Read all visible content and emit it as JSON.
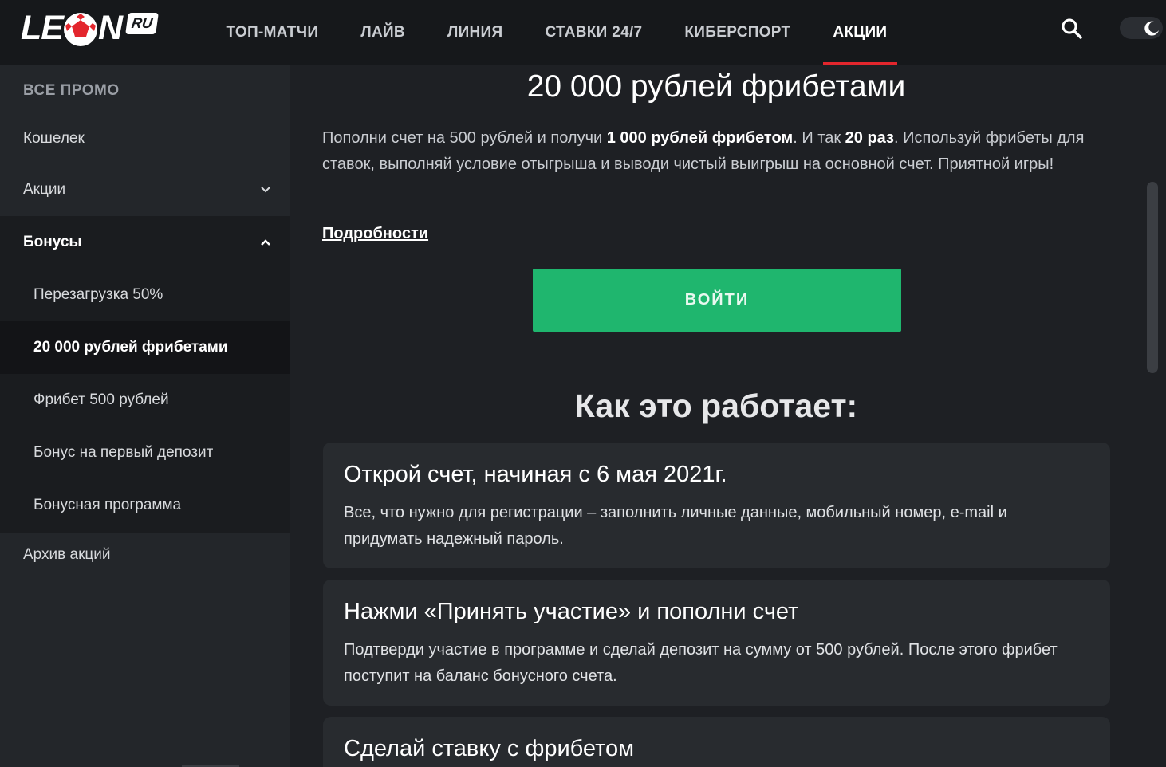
{
  "header": {
    "logo_text_left": "LE",
    "logo_text_right": "N",
    "logo_badge": "RU",
    "nav": [
      {
        "label": "ТОП-МАТЧИ"
      },
      {
        "label": "ЛАЙВ"
      },
      {
        "label": "ЛИНИЯ"
      },
      {
        "label": "СТАВКИ 24/7"
      },
      {
        "label": "КИБЕРСПОРТ"
      },
      {
        "label": "АКЦИИ",
        "active": true
      }
    ],
    "icons": {
      "search": "search-icon",
      "theme": "moon-icon"
    }
  },
  "sidebar": {
    "heading": "ВСЕ ПРОМО",
    "items": [
      {
        "label": "Кошелек"
      },
      {
        "label": "Акции",
        "expandable": true,
        "expanded": false
      },
      {
        "label": "Бонусы",
        "expandable": true,
        "expanded": true
      }
    ],
    "bonus_items": [
      {
        "label": "Перезагрузка 50%"
      },
      {
        "label": "20 000 рублей фрибетами",
        "selected": true
      },
      {
        "label": "Фрибет 500 рублей"
      },
      {
        "label": "Бонус на первый депозит"
      },
      {
        "label": "Бонусная программа"
      }
    ],
    "archive": "Архив акций"
  },
  "main": {
    "title": "20 000 рублей фрибетами",
    "desc_1": "Пополни счет на 500 рублей и получи ",
    "desc_bold_1": "1 000 рублей фрибетом",
    "desc_2": ". И так ",
    "desc_bold_2": "20 раз",
    "desc_3": ". Используй фрибеты для ставок, выполняй условие отыгрыша и выводи чистый выигрыш на основной счет. Приятной игры!",
    "details_link": "Подробности",
    "login_button": "ВОЙТИ",
    "how_title": "Как это работает:",
    "steps": [
      {
        "title": "Открой счет, начиная с 6 мая 2021г.",
        "text": "Все, что нужно для регистрации – заполнить личные данные, мобильный номер, e-mail и придумать надежный пароль."
      },
      {
        "title": "Нажми «Принять участие» и пополни счет",
        "text": "Подтверди участие в программе и сделай депозит на сумму от 500 рублей. После этого фрибет поступит на баланс бонусного счета."
      },
      {
        "title": "Сделай ставку с фрибетом",
        "text": ""
      }
    ]
  },
  "colors": {
    "accent_red": "#e3262d",
    "button_green": "#1fb66e",
    "bg_dark": "#1e2024",
    "header_bg": "#16181b"
  }
}
